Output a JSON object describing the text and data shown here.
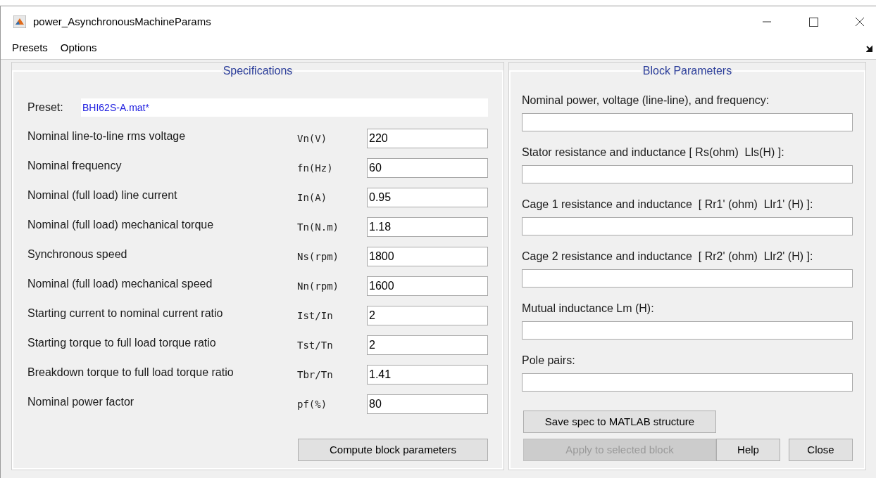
{
  "window": {
    "title": "power_AsynchronousMachineParams"
  },
  "menu": [
    "Presets",
    "Options"
  ],
  "specifications": {
    "title": "Specifications",
    "preset_label": "Preset:",
    "preset_value": "BHI62S-A.mat*",
    "rows": [
      {
        "label": "Nominal line-to-line rms voltage",
        "symbol": "Vn(V)",
        "value": "220"
      },
      {
        "label": "Nominal frequency",
        "symbol": "fn(Hz)",
        "value": "60"
      },
      {
        "label": "Nominal (full load) line current",
        "symbol": "In(A)",
        "value": "0.95"
      },
      {
        "label": "Nominal (full load) mechanical torque",
        "symbol": "Tn(N.m)",
        "value": "1.18"
      },
      {
        "label": "Synchronous speed",
        "symbol": "Ns(rpm)",
        "value": "1800"
      },
      {
        "label": "Nominal (full load) mechanical speed",
        "symbol": "Nn(rpm)",
        "value": "1600"
      },
      {
        "label": "Starting current to nominal current ratio",
        "symbol": "Ist/In",
        "value": "2"
      },
      {
        "label": "Starting torque to full load torque ratio",
        "symbol": "Tst/Tn",
        "value": "2"
      },
      {
        "label": "Breakdown torque to full load torque ratio",
        "symbol": "Tbr/Tn",
        "value": "1.41"
      },
      {
        "label": "Nominal power factor",
        "symbol": "pf(%)",
        "value": "80"
      }
    ],
    "compute_button": {
      "label": "Compute block parameters",
      "disabled": false
    }
  },
  "block_parameters": {
    "title": "Block Parameters",
    "fields": [
      {
        "label": "Nominal power, voltage (line-line), and frequency:"
      },
      {
        "label": "Stator resistance and inductance [ Rs(ohm)  Lls(H) ]:"
      },
      {
        "label": "Cage 1 resistance and inductance  [ Rr1' (ohm)  Llr1' (H) ]:"
      },
      {
        "label": "Cage 2 resistance and inductance  [ Rr2' (ohm)  Llr2' (H) ]:"
      },
      {
        "label": "Mutual inductance Lm (H):"
      },
      {
        "label": "Pole pairs:"
      }
    ],
    "save_button": {
      "label": "Save spec to MATLAB structure",
      "disabled": false
    },
    "apply_button": {
      "label": "Apply to selected block",
      "disabled": true
    },
    "help_button": {
      "label": "Help",
      "disabled": false
    },
    "close_button": {
      "label": "Close",
      "disabled": false
    }
  }
}
